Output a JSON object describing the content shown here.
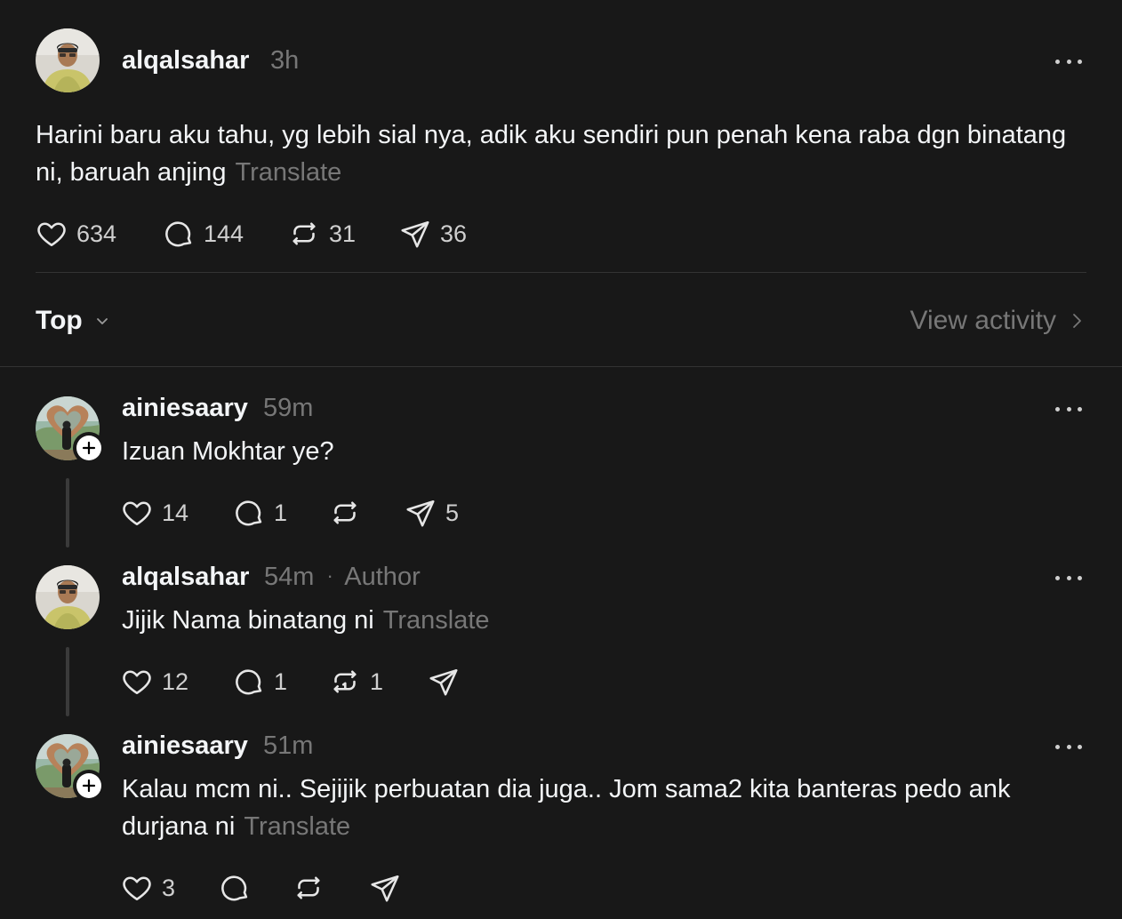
{
  "post": {
    "username": "alqalsahar",
    "time": "3h",
    "text": "Harini baru aku tahu, yg lebih sial nya, adik aku sendiri pun penah kena raba dgn binatang ni, baruah anjing",
    "translate": "Translate",
    "likes": "634",
    "comments": "144",
    "reposts": "31",
    "shares": "36"
  },
  "sort": {
    "label": "Top",
    "view_activity": "View activity"
  },
  "replies": [
    {
      "username": "ainiesaary",
      "time": "59m",
      "text": "Izuan Mokhtar ye?",
      "likes": "14",
      "comments": "1",
      "reposts": "",
      "shares": "5"
    },
    {
      "username": "alqalsahar",
      "time": "54m",
      "separator": "·",
      "badge": "Author",
      "text": "Jijik Nama binatang ni",
      "translate": "Translate",
      "likes": "12",
      "comments": "1",
      "reposts": "1",
      "shares": ""
    },
    {
      "username": "ainiesaary",
      "time": "51m",
      "text": "Kalau mcm ni.. Sejijik perbuatan dia juga.. Jom sama2 kita banteras pedo ank durjana ni",
      "translate": "Translate",
      "likes": "3",
      "comments": "",
      "reposts": "",
      "shares": ""
    }
  ],
  "icons": {
    "like": "heart-icon",
    "comment": "comment-bubble-icon",
    "repost": "repost-icon",
    "share": "send-icon",
    "more": "more-horizontal-icon",
    "sort": "chevron-down-icon",
    "view": "chevron-right-icon",
    "follow": "plus-icon"
  },
  "colors": {
    "background": "#181818",
    "text": "#f3f5f7",
    "muted": "#777777",
    "divider": "#333333"
  }
}
